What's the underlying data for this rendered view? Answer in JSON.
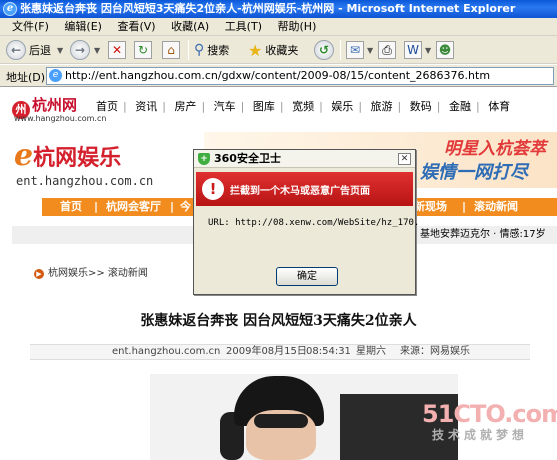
{
  "window": {
    "title": "张惠妹返台奔丧 因台风短短3天痛失2位亲人-杭州网娱乐-杭州网 - Microsoft Internet Explorer"
  },
  "menu": [
    "文件(F)",
    "编辑(E)",
    "查看(V)",
    "收藏(A)",
    "工具(T)",
    "帮助(H)"
  ],
  "toolbar": {
    "back_label": "后退",
    "search_label": "搜索",
    "favorites_label": "收藏夹"
  },
  "address": {
    "label": "地址(D)",
    "url": "http://ent.hangzhou.com.cn/gdxw/content/2009-08/15/content_2686376.htm"
  },
  "site": {
    "logo_text": "杭州网",
    "logo_url": "www.hangzhou.com.cn",
    "nav": [
      "首页",
      "资讯",
      "房产",
      "汽车",
      "图库",
      "宽频",
      "娱乐",
      "旅游",
      "数码",
      "金融",
      "体育"
    ],
    "ent_logo_e": "e",
    "ent_logo_cn": "杭网娱乐",
    "ent_domain": "ent.hangzhou.com.cn",
    "banner_line1": "明星入杭荟萃",
    "banner_line2": "娱情一网打尽",
    "orange_nav": [
      "首页",
      "杭网会客厅",
      "今",
      "新现场",
      "滚动新闻"
    ],
    "subinfo": "基地安葬迈克尔 · 情感:17岁",
    "breadcrumb": "杭网娱乐>> 滚动新闻"
  },
  "article": {
    "headline": "张惠妹返台奔丧 因台风短短3天痛失2位亲人",
    "source_site": "ent.hangzhou.com.cn",
    "date": "2009年08月15日",
    "time": "08:54:31",
    "weekday": "星期六",
    "source": "来源：网易娱乐"
  },
  "dialog": {
    "title": "360安全卫士",
    "heading": "拦截到一个木马或恶意广告页面",
    "url_text": "URL: http://08.xenw.com/WebSite/hz_170.",
    "ok_label": "确定"
  },
  "watermark": {
    "line1": "51CTO.com",
    "line2": "技术成就梦想"
  }
}
